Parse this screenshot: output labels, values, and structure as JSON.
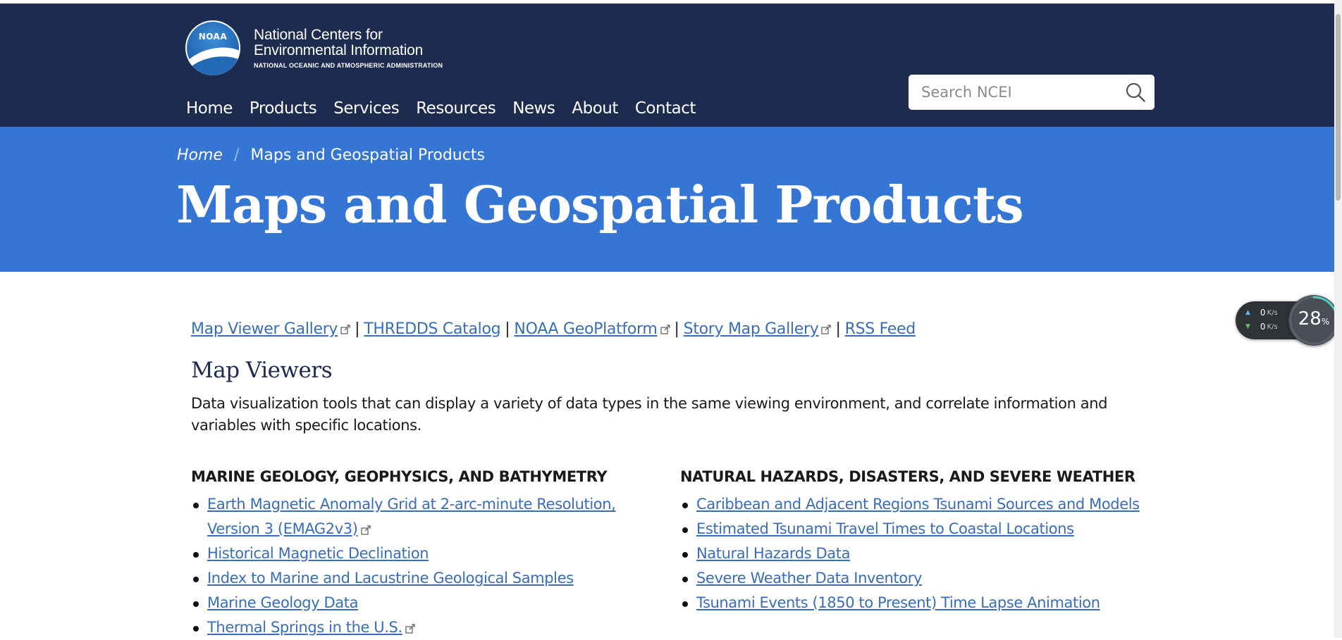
{
  "brand": {
    "logo_text": "NOAA",
    "line1": "National Centers for",
    "line2": "Environmental Information",
    "subline": "NATIONAL OCEANIC AND ATMOSPHERIC ADMINISTRATION"
  },
  "nav": {
    "items": [
      "Home",
      "Products",
      "Services",
      "Resources",
      "News",
      "About",
      "Contact"
    ]
  },
  "search": {
    "placeholder": "Search NCEI",
    "icon": "search-icon"
  },
  "breadcrumb": {
    "home": "Home",
    "current": "Maps and Geospatial Products"
  },
  "page": {
    "title": "Maps and Geospatial Products"
  },
  "quicklinks": {
    "items": [
      {
        "label": "Map Viewer Gallery",
        "external": true
      },
      {
        "label": "THREDDS Catalog",
        "external": false
      },
      {
        "label": "NOAA GeoPlatform",
        "external": true
      },
      {
        "label": "Story Map Gallery",
        "external": true
      },
      {
        "label": "RSS Feed",
        "external": false
      }
    ],
    "separator": "|"
  },
  "map_viewers": {
    "title": "Map Viewers",
    "description": "Data visualization tools that can display a variety of data types in the same viewing environment, and correlate information and variables with specific locations.",
    "left": {
      "heading": "MARINE GEOLOGY, GEOPHYSICS, AND BATHYMETRY",
      "items": [
        {
          "label": "Earth Magnetic Anomaly Grid at 2-arc-minute Resolution, Version 3 (EMAG2v3)",
          "external": true
        },
        {
          "label": "Historical Magnetic Declination",
          "external": false
        },
        {
          "label": "Index to Marine and Lacustrine Geological Samples",
          "external": false
        },
        {
          "label": "Marine Geology Data",
          "external": false
        },
        {
          "label": "Thermal Springs in the U.S.",
          "external": true
        }
      ]
    },
    "right": {
      "heading": "NATURAL HAZARDS, DISASTERS, AND SEVERE WEATHER",
      "items": [
        {
          "label": "Caribbean and Adjacent Regions Tsunami Sources and Models",
          "external": false
        },
        {
          "label": "Estimated Tsunami Travel Times to Coastal Locations",
          "external": false
        },
        {
          "label": "Natural Hazards Data",
          "external": false
        },
        {
          "label": "Severe Weather Data Inventory",
          "external": false
        },
        {
          "label": "Tsunami Events (1850 to Present) Time Lapse Animation",
          "external": false
        }
      ]
    }
  },
  "net_widget": {
    "upload_value": "0",
    "upload_unit": "K/s",
    "download_value": "0",
    "download_unit": "K/s",
    "cpu_value": "28",
    "cpu_unit": "%",
    "cpu_fraction": 0.28
  },
  "colors": {
    "header_bg": "#1d2b4f",
    "hero_bg": "#3575d3",
    "link": "#3a6db5"
  }
}
